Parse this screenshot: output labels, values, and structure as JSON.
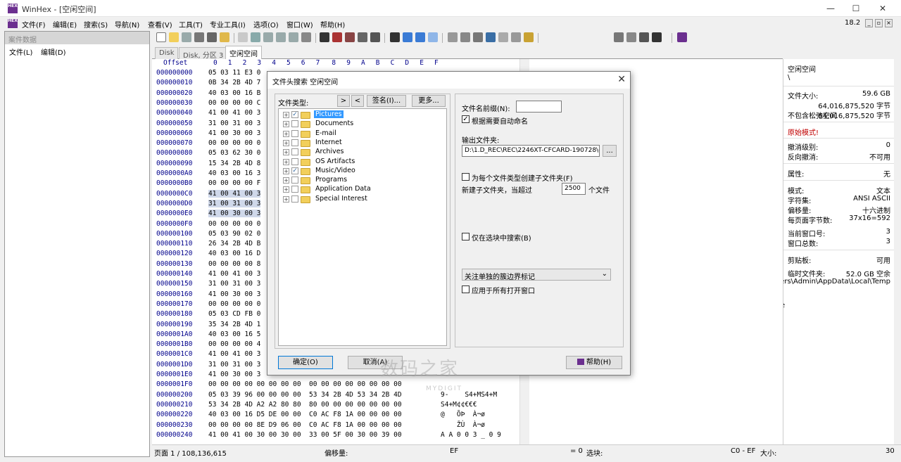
{
  "window": {
    "title": "WinHex - [空闲空间]",
    "app_icon": "HEX",
    "minimize": "—",
    "maximize": "☐",
    "close": "✕"
  },
  "menu": {
    "items": [
      "文件(F)",
      "编辑(E)",
      "搜索(S)",
      "导航(N)",
      "查看(V)",
      "工具(T)",
      "专业工具(I)",
      "选项(O)",
      "窗口(W)",
      "帮助(H)"
    ],
    "version": "18.2",
    "mini_buttons": [
      "_",
      "▫",
      "×"
    ]
  },
  "left_panel": {
    "header": "案件数据",
    "menu_file": "文件(L)",
    "menu_edit": "编辑(D)"
  },
  "tabs": [
    "Disk",
    "Disk, 分区 3",
    "空闲空间"
  ],
  "hex": {
    "header": "  Offset      0  1  2  3  4  5  6  7   8  9  A  B  C  D  E  F",
    "rows": [
      {
        "off": "000000000",
        "bytes": "05 03 11 E3 0",
        "ascii": ""
      },
      {
        "off": "000000010",
        "bytes": "0B 34 2B 4D 7",
        "ascii": ""
      },
      {
        "off": "000000020",
        "bytes": "40 03 00 16 B",
        "ascii": ""
      },
      {
        "off": "000000030",
        "bytes": "00 00 00 00 C",
        "ascii": ""
      },
      {
        "off": "000000040",
        "bytes": "41 00 41 00 3",
        "ascii": ""
      },
      {
        "off": "000000050",
        "bytes": "31 00 31 00 3",
        "ascii": ""
      },
      {
        "off": "000000060",
        "bytes": "41 00 30 00 3",
        "ascii": ""
      },
      {
        "off": "000000070",
        "bytes": "00 00 00 00 0",
        "ascii": ""
      },
      {
        "off": "000000080",
        "bytes": "05 03 62 30 0",
        "ascii": ""
      },
      {
        "off": "000000090",
        "bytes": "15 34 2B 4D 8",
        "ascii": ""
      },
      {
        "off": "0000000A0",
        "bytes": "40 03 00 16 3",
        "ascii": ""
      },
      {
        "off": "0000000B0",
        "bytes": "00 00 00 00 F",
        "ascii": ""
      },
      {
        "off": "0000000C0",
        "bytes": "41 00 41 00 3",
        "ascii": "",
        "hl": true
      },
      {
        "off": "0000000D0",
        "bytes": "31 00 31 00 3",
        "ascii": "",
        "hl": true
      },
      {
        "off": "0000000E0",
        "bytes": "41 00 30 00 3",
        "ascii": "",
        "hl": true
      },
      {
        "off": "0000000F0",
        "bytes": "00 00 00 00 0",
        "ascii": ""
      },
      {
        "off": "000000100",
        "bytes": "05 03 90 02 0",
        "ascii": ""
      },
      {
        "off": "000000110",
        "bytes": "26 34 2B 4D B",
        "ascii": ""
      },
      {
        "off": "000000120",
        "bytes": "40 03 00 16 D",
        "ascii": ""
      },
      {
        "off": "000000130",
        "bytes": "00 00 00 00 8",
        "ascii": ""
      },
      {
        "off": "000000140",
        "bytes": "41 00 41 00 3",
        "ascii": ""
      },
      {
        "off": "000000150",
        "bytes": "31 00 31 00 3",
        "ascii": ""
      },
      {
        "off": "000000160",
        "bytes": "41 00 30 00 3",
        "ascii": ""
      },
      {
        "off": "000000170",
        "bytes": "00 00 00 00 0",
        "ascii": ""
      },
      {
        "off": "000000180",
        "bytes": "05 03 CD FB 0",
        "ascii": ""
      },
      {
        "off": "000000190",
        "bytes": "35 34 2B 4D 1",
        "ascii": ""
      },
      {
        "off": "0000001A0",
        "bytes": "40 03 00 16 5",
        "ascii": ""
      },
      {
        "off": "0000001B0",
        "bytes": "00 00 00 00 4",
        "ascii": ""
      },
      {
        "off": "0000001C0",
        "bytes": "41 00 41 00 3",
        "ascii": ""
      },
      {
        "off": "0000001D0",
        "bytes": "31 00 31 00 3",
        "ascii": ""
      },
      {
        "off": "0000001E0",
        "bytes": "41 00 30 00 3",
        "ascii": ""
      },
      {
        "off": "0000001F0",
        "bytes": "00 00 00 00 00 00 00 00  00 00 00 00 00 00 00 00",
        "ascii": ""
      },
      {
        "off": "000000200",
        "bytes": "05 03 39 96 00 00 00 00  53 34 2B 4D 53 34 2B 4D",
        "ascii": "9-    S4+MS4+M"
      },
      {
        "off": "000000210",
        "bytes": "53 34 2B 4D A2 A2 80 80  80 00 00 00 00 00 00 00",
        "ascii": "S4+M¢¢€€€"
      },
      {
        "off": "000000220",
        "bytes": "40 03 00 16 D5 DE 00 00  C0 AC F8 1A 00 00 00 00",
        "ascii": "@   ÕÞ  À¬ø"
      },
      {
        "off": "000000230",
        "bytes": "00 00 00 00 8E D9 06 00  C0 AC F8 1A 00 00 00 00",
        "ascii": "    ŽÙ  À¬ø"
      },
      {
        "off": "000000240",
        "bytes": "41 00 41 00 30 00 30 00  33 00 5F 00 30 00 39 00",
        "ascii": "A A 0 0 3 _ 0 9"
      }
    ]
  },
  "info": {
    "path1": "空闲空间",
    "path2": "\\",
    "file_size_label": "文件大小:",
    "file_size_gb": "59.6 GB",
    "file_size_bytes": "64,016,875,520 字节",
    "no_slack_label": "不包含松弛空间",
    "no_slack_value": "64,016,875,520 字节",
    "mode_orig": "原始模式!",
    "undo_level_label": "撤消级别:",
    "undo_level_value": "0",
    "reverse_undo_label": "反向撤消:",
    "reverse_undo_value": "不可用",
    "attr_label": "属性:",
    "attr_value": "无",
    "mode_label": "模式:",
    "mode_value": "文本",
    "charset_label": "字符集:",
    "charset_value": "ANSI ASCII",
    "offset_label": "偏移量:",
    "offset_value": "十六进制",
    "bpp_label": "每页面字节数:",
    "bpp_value": "37x16=592",
    "curwin_label": "当前窗口号:",
    "curwin_value": "3",
    "totalwin_label": "窗口总数:",
    "totalwin_value": "3",
    "clipboard_label": "剪贴板:",
    "clipboard_value": "可用",
    "temp_label": "临时文件夹:",
    "temp_value": "52.0 GB 空余",
    "temp_path": "ers\\Admin\\AppData\\Local\\Temp",
    "stray": "e"
  },
  "status": {
    "page": "页面 1 / 108,136,615",
    "offset_label": "偏移量:",
    "offset_value": "EF",
    "eq": "= 0",
    "selection_label": "选块:",
    "range": "C0 - EF",
    "size_label": "大小:",
    "size_value": "30"
  },
  "dialog": {
    "title": "文件头搜索 空闲空间",
    "close": "✕",
    "file_types_label": "文件类型:",
    "btn_next": ">",
    "btn_prev": "<",
    "btn_signature": "签名(I)...",
    "btn_more": "更多...",
    "tree": [
      {
        "label": "Pictures",
        "checked": true,
        "selected": true
      },
      {
        "label": "Documents",
        "checked": false
      },
      {
        "label": "E-mail",
        "checked": false
      },
      {
        "label": "Internet",
        "checked": false
      },
      {
        "label": "Archives",
        "checked": false
      },
      {
        "label": "OS Artifacts",
        "checked": false
      },
      {
        "label": "Music/Video",
        "checked": true
      },
      {
        "label": "Programs",
        "checked": false
      },
      {
        "label": "Application Data",
        "checked": false
      },
      {
        "label": "Special Interest",
        "checked": false
      }
    ],
    "prefix_label": "文件名前缀(N):",
    "prefix_value": "",
    "auto_name_label": "根据需要自动命名",
    "auto_name_checked": "✓",
    "output_label": "输出文件夹:",
    "output_value": "D:\\1.D_REC\\REC\\2246XT-CFCARD-190728\\d",
    "browse": "...",
    "subfolder_label": "为每个文件类型创建子文件夹(F)",
    "new_sub_label": "新建子文件夹，当超过",
    "new_sub_value": "2500",
    "new_sub_unit": "个文件",
    "only_block_label": "仅在选块中搜索(B)",
    "cluster_select": "关注单独的簇边界标记",
    "apply_all_label": "应用于所有打开窗口",
    "ok": "确定(O)",
    "cancel": "取消(A)",
    "help": "帮助(H)"
  },
  "watermark": {
    "text": "数码之家",
    "sub": "MYDIGIT"
  }
}
